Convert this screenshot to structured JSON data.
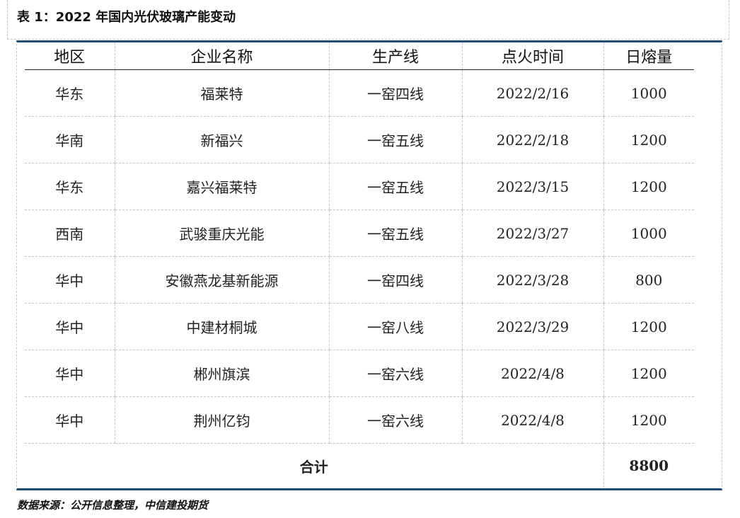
{
  "title": "表 1：2022 年国内光伏玻璃产能变动",
  "table": {
    "headers": [
      "地区",
      "企业名称",
      "生产线",
      "点火时间",
      "日熔量"
    ],
    "rows": [
      [
        "华东",
        "福莱特",
        "一窑四线",
        "2022/2/16",
        "1000"
      ],
      [
        "华南",
        "新福兴",
        "一窑五线",
        "2022/2/18",
        "1200"
      ],
      [
        "华东",
        "嘉兴福莱特",
        "一窑五线",
        "2022/3/15",
        "1200"
      ],
      [
        "西南",
        "武骏重庆光能",
        "一窑五线",
        "2022/3/27",
        "1000"
      ],
      [
        "华中",
        "安徽燕龙基新能源",
        "一窑四线",
        "2022/3/28",
        "800"
      ],
      [
        "华中",
        "中建材桐城",
        "一窑八线",
        "2022/3/29",
        "1200"
      ],
      [
        "华中",
        "郴州旗滨",
        "一窑六线",
        "2022/4/8",
        "1200"
      ],
      [
        "华中",
        "荆州亿钧",
        "一窑六线",
        "2022/4/8",
        "1200"
      ]
    ],
    "total_label": "合计",
    "total_value": "8800"
  },
  "source": "数据来源：公开信息整理，中信建投期货"
}
